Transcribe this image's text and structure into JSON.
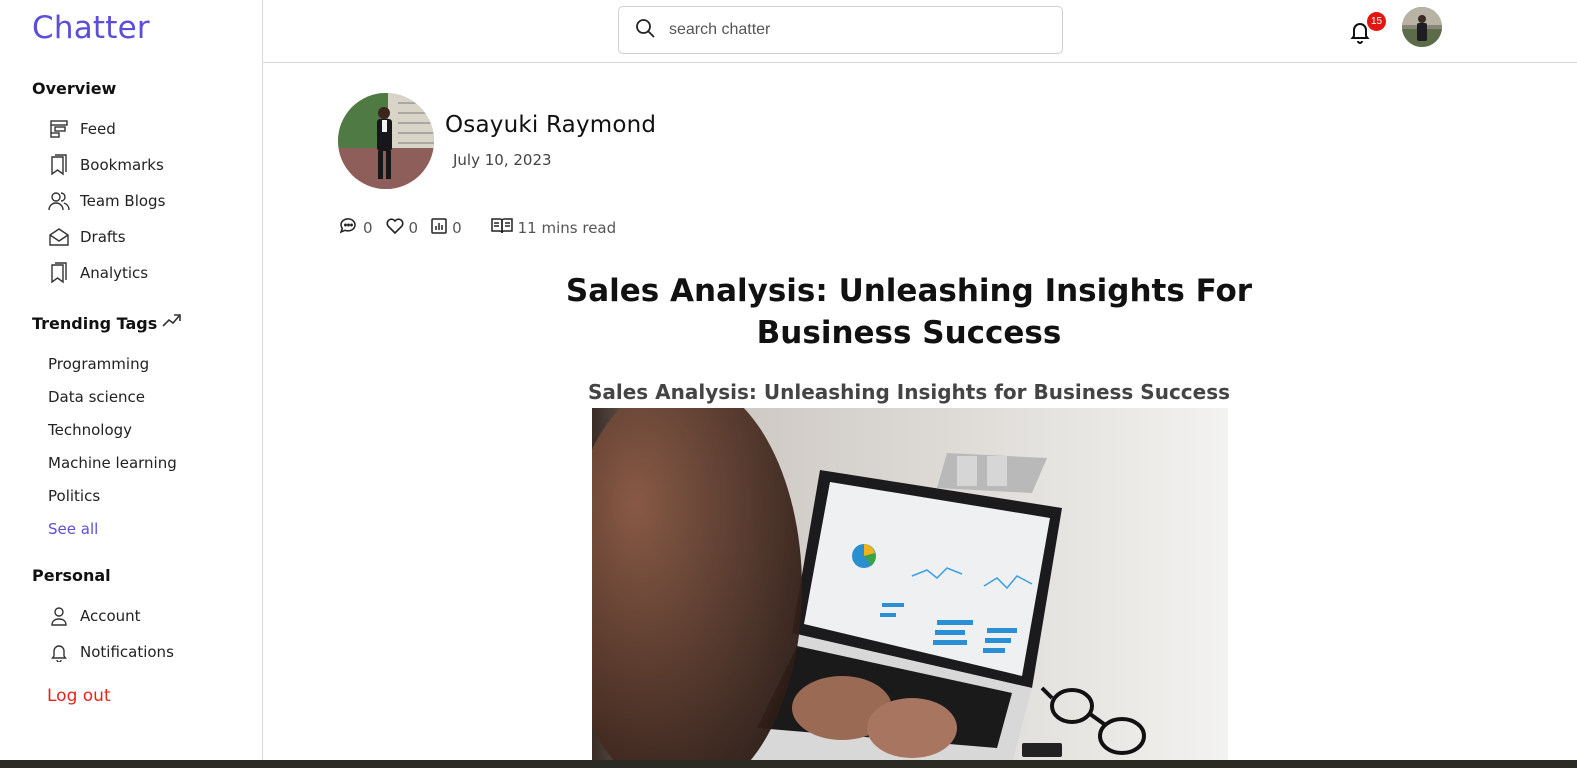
{
  "brand": "Chatter",
  "sidebar": {
    "overview_title": "Overview",
    "overview_items": [
      {
        "label": "Feed",
        "icon": "feed-icon"
      },
      {
        "label": "Bookmarks",
        "icon": "bookmark-icon"
      },
      {
        "label": "Team Blogs",
        "icon": "team-icon"
      },
      {
        "label": "Drafts",
        "icon": "drafts-icon"
      },
      {
        "label": "Analytics",
        "icon": "analytics-icon"
      }
    ],
    "trending_title": "Trending Tags",
    "tags": [
      "Programming",
      "Data science",
      "Technology",
      "Machine learning",
      "Politics"
    ],
    "see_all": "See all",
    "personal_title": "Personal",
    "personal_items": [
      {
        "label": "Account",
        "icon": "user-icon"
      },
      {
        "label": "Notifications",
        "icon": "bell-icon"
      }
    ],
    "logout": "Log out"
  },
  "topbar": {
    "search_placeholder": "search chatter",
    "notification_count": "15"
  },
  "post": {
    "author": "Osayuki Raymond",
    "date": "July 10, 2023",
    "comments": "0",
    "likes": "0",
    "views": "0",
    "read_time": "11 mins read",
    "title": "Sales Analysis: Unleashing Insights For Business Success",
    "subtitle": "Sales Analysis: Unleashing Insights for Business Success"
  },
  "colors": {
    "brand": "#5b4fd9",
    "logout": "#e5251c",
    "badge": "#e3160f"
  }
}
